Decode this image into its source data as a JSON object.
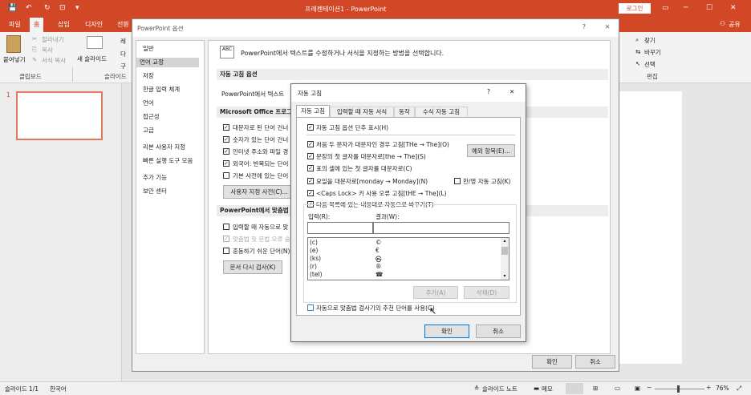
{
  "app": {
    "title": "프레젠테이션1 - PowerPoint",
    "login": "로그인",
    "qat_glyphs": [
      "💾",
      "↶",
      "↻",
      "⊡",
      "▾"
    ],
    "win_controls": [
      "▭",
      "─",
      "☐",
      "✕"
    ]
  },
  "tabs": [
    "파일",
    "홈",
    "삽입",
    "디자인",
    "전환"
  ],
  "share": "공유",
  "ribbon": {
    "paste": "붙여넣기",
    "cut": "잘라내기",
    "copy": "복사",
    "format_painter": "서식 복사",
    "clipboard": "클립보드",
    "new_slide": "새 슬라이드",
    "slides_group": "슬라이드",
    "find": "찾기",
    "replace": "바꾸기",
    "select": "선택",
    "edit_group": "편집",
    "partial_1": "레",
    "partial_2": "다",
    "partial_3": "구"
  },
  "slide_thumb_number": "1",
  "options_dialog": {
    "title": "PowerPoint 옵션",
    "help": "?",
    "close": "✕",
    "nav": [
      "일반",
      "언어 교정",
      "저장",
      "한글 입력 체계",
      "언어",
      "접근성",
      "고급",
      "리본 사용자 지정",
      "빠른 실행 도구 모음",
      "추가 기능",
      "보안 센터"
    ],
    "selected_nav": 1,
    "header_text": "PowerPoint에서 텍스트를 수정하거나 서식을 지정하는 방법을 선택합니다.",
    "section1": "자동 고침 옵션",
    "section1_text": "PowerPoint에서 텍스트",
    "section2": "Microsoft Office 프로그",
    "s2_items": [
      "대문자로 된 단어 건너",
      "숫자가 있는 단어 건너",
      "인터넷 주소와 파일 경",
      "외국어: 반복되는 단어",
      "기본 사전에 있는 단어"
    ],
    "custom_dict": "사용자 지정 사전(C)...",
    "section3": "PowerPoint에서 맞춤법 검",
    "s3_items": [
      "입력할 때 자동으로 맞",
      "맞춤법 및 문법 오류 숨",
      "혼동하기 쉬운 단어(N)"
    ],
    "recheck": "문서 다시 검사(K)",
    "ok": "확인",
    "cancel": "취소"
  },
  "autocorrect": {
    "title": "자동 고침",
    "help": "?",
    "close": "✕",
    "tabs": [
      "자동 고침",
      "입력할 때 자동 서식",
      "동작",
      "수식 자동 고침"
    ],
    "show_buttons": "자동 고침 옵션 단추 표시(H)",
    "options": [
      "처음 두 문자가 대문자인 경우 고침[THe → The](O)",
      "문장의 첫 글자를 대문자로[the → The](S)",
      "표의 셀에 있는 첫 글자를 대문자로(C)",
      "요일을 대문자로[monday → Monday](N)",
      "<Caps Lock> 키 사용 오류 고침[tHE → The](L)",
      "다음 목록에 있는 내용대로 자동으로 바꾸기(T)"
    ],
    "exceptions": "예외 항목(E)...",
    "hanyoung": "한/영 자동 고침(K)",
    "input_label": "입력(R):",
    "result_label": "결과(W):",
    "list": [
      {
        "in": "(c)",
        "out": "©"
      },
      {
        "in": "(e)",
        "out": "€"
      },
      {
        "in": "(ks)",
        "out": "㉿"
      },
      {
        "in": "(r)",
        "out": "®"
      },
      {
        "in": "(tel)",
        "out": "☎"
      }
    ],
    "add": "추가(A)",
    "delete": "삭제(D)",
    "spell_suggest": "자동으로 맞춤법 검사기의 추천 단어를 사용(G)",
    "ok": "확인",
    "cancel": "취소"
  },
  "status": {
    "slide": "슬라이드 1/1",
    "lang": "한국어",
    "notes": "슬라이드 노트",
    "memo": "메모",
    "zoom": "76%",
    "minus": "−",
    "plus": "+"
  }
}
